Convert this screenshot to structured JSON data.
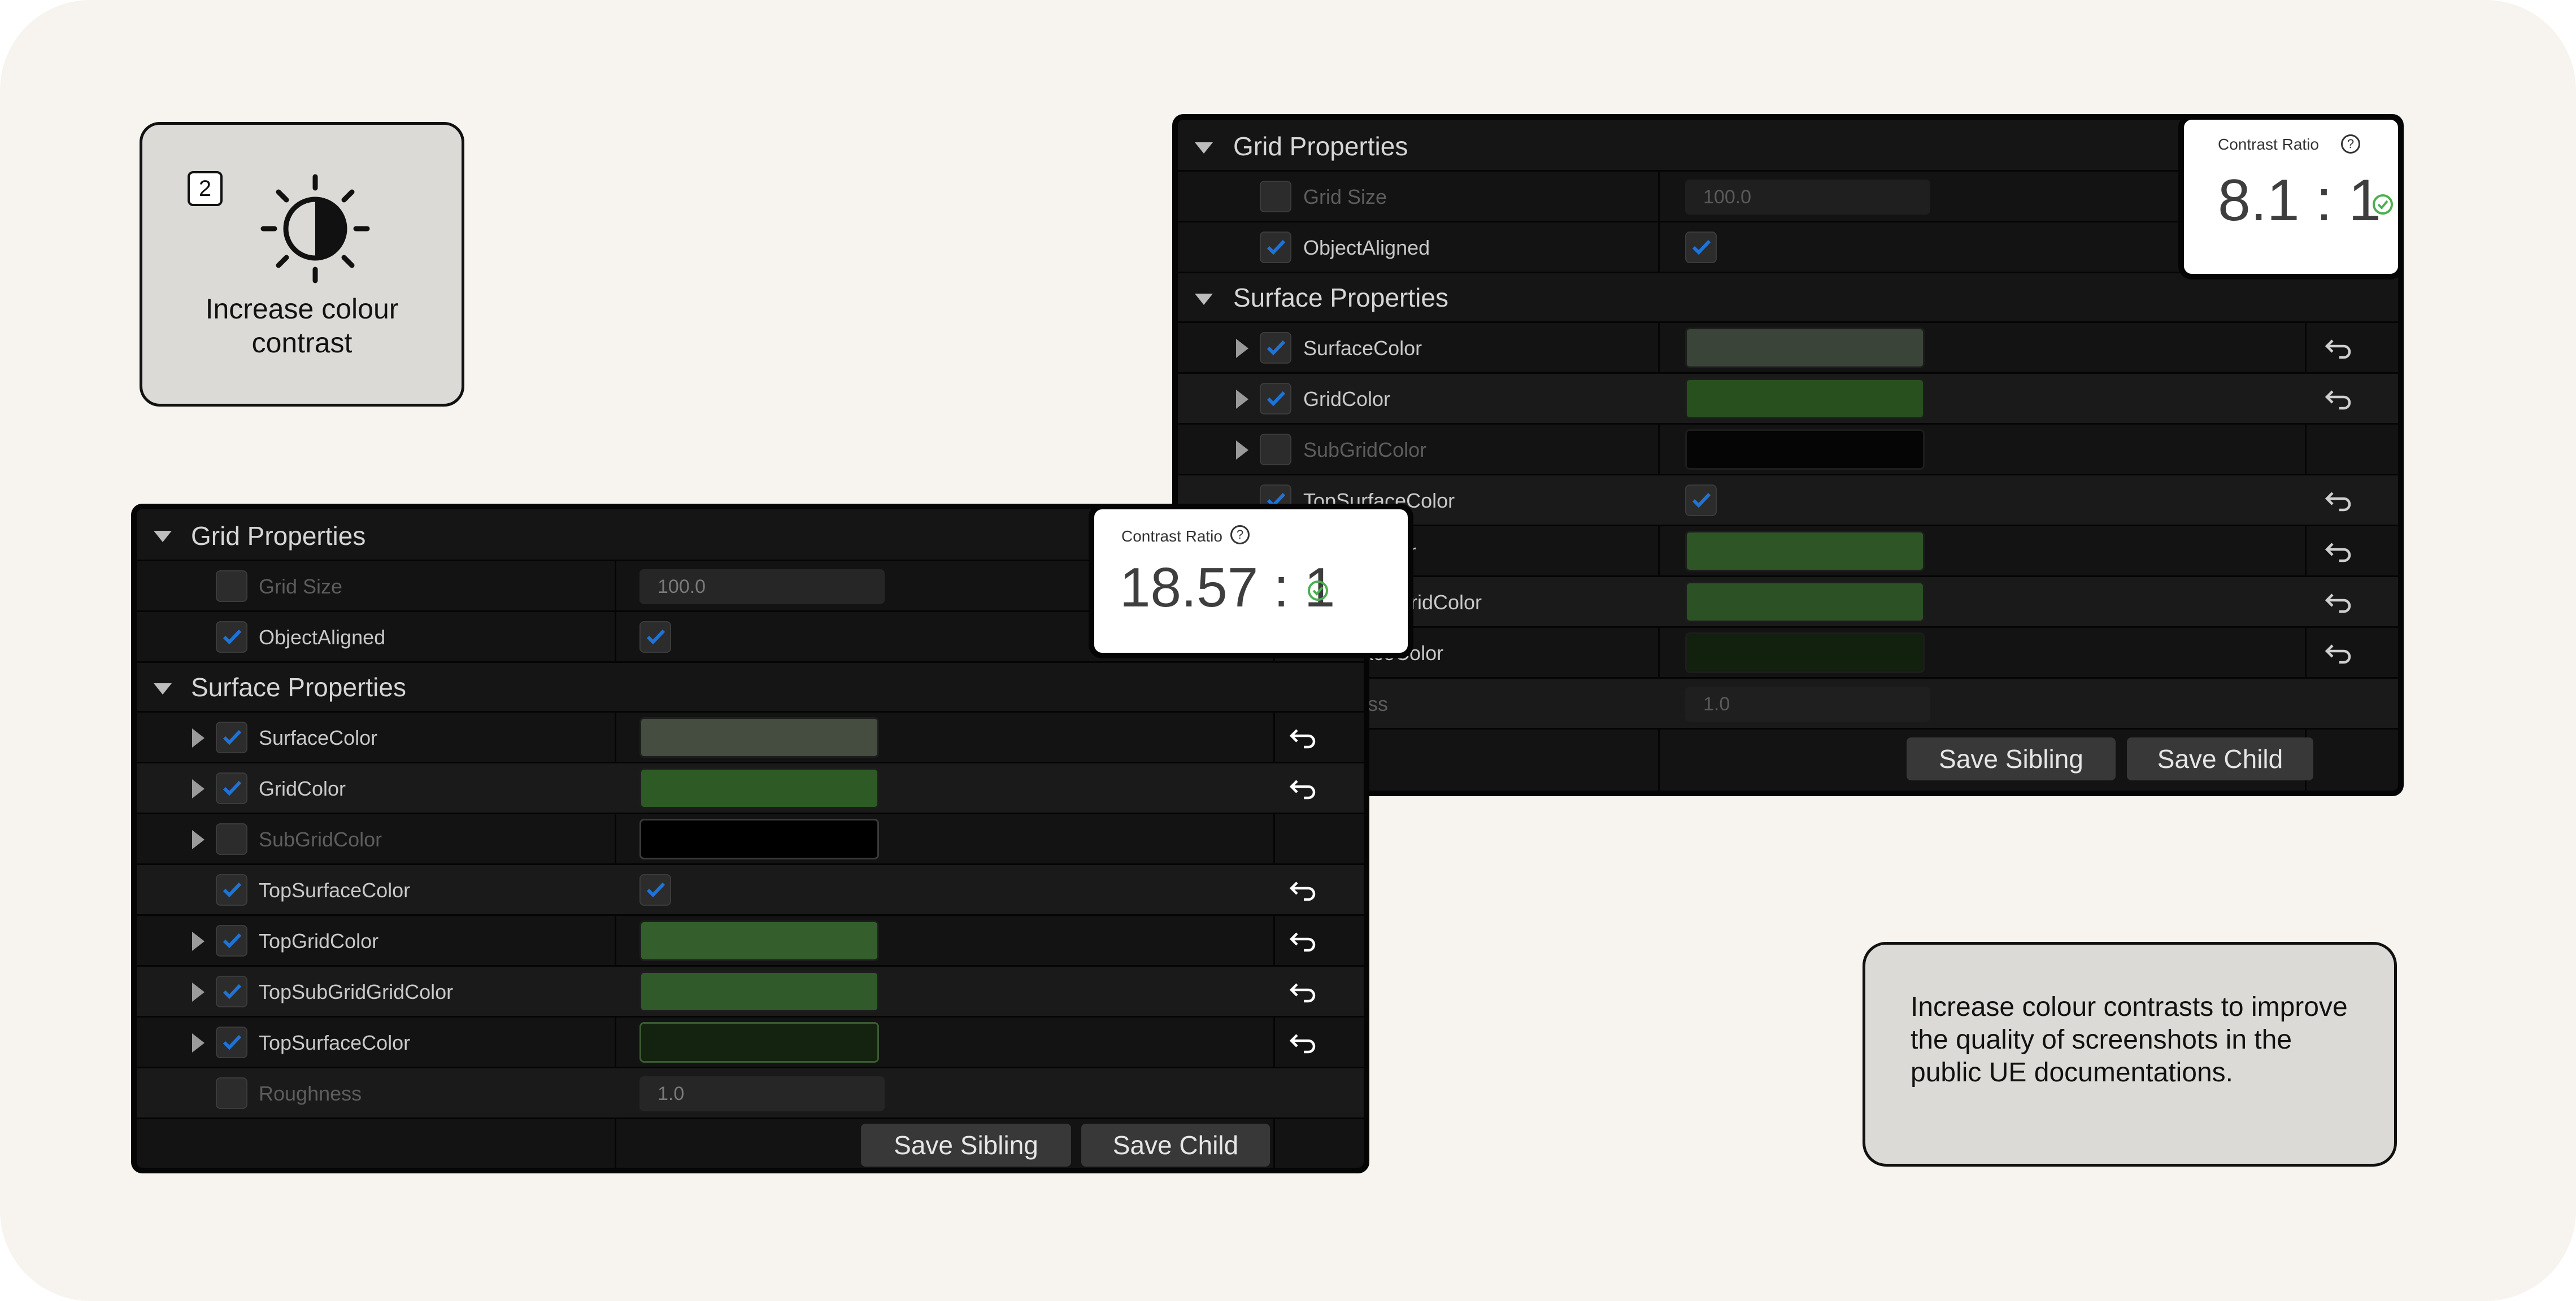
{
  "tip": {
    "number": "2",
    "icon": "contrast-sun-icon",
    "title": "Increase colour contrast"
  },
  "note": {
    "text": "Increase colour contrasts to improve the quality of screenshots in the public UE documentations."
  },
  "panel_after": {
    "categories": {
      "grid": "Grid Properties",
      "surface": "Surface Properties"
    },
    "grid_rows": [
      {
        "label": "Grid Size",
        "enabled": false,
        "value": "100.0"
      },
      {
        "label": "ObjectAligned",
        "enabled": true,
        "value_checked": true
      }
    ],
    "surface_rows": [
      {
        "label": "SurfaceColor",
        "enabled": true,
        "expandable": true,
        "color": "#444d40",
        "resettable": true
      },
      {
        "label": "GridColor",
        "enabled": true,
        "expandable": true,
        "color": "#2d5a25",
        "resettable": true
      },
      {
        "label": "SubGridColor",
        "enabled": false,
        "expandable": true,
        "color": "#000000",
        "resettable": false
      },
      {
        "label": "TopSurfaceColor",
        "enabled": true,
        "expandable": false,
        "value_checked": true,
        "resettable": true
      },
      {
        "label": "TopGridColor",
        "enabled": true,
        "expandable": true,
        "color": "#345f2c",
        "resettable": true
      },
      {
        "label": "TopSubGridGridColor",
        "enabled": true,
        "expandable": true,
        "color": "#305a2a",
        "resettable": true
      },
      {
        "label": "TopSurfaceColor",
        "enabled": true,
        "expandable": true,
        "color": "#13230f",
        "resettable": true
      },
      {
        "label": "Roughness",
        "enabled": false,
        "expandable": false,
        "value": "1.0",
        "resettable": false
      }
    ],
    "buttons": {
      "save_sibling": "Save Sibling",
      "save_child": "Save Child"
    },
    "contrast": {
      "label": "Contrast Ratio",
      "value": "18.57 : 1",
      "status": "pass"
    }
  },
  "panel_before": {
    "categories": {
      "grid": "Grid Properties",
      "surface": "Surface Properties"
    },
    "grid_rows": [
      {
        "label": "Grid Size",
        "enabled": false,
        "value": "100.0"
      },
      {
        "label": "ObjectAligned",
        "enabled": true,
        "value_checked": true
      }
    ],
    "surface_rows": [
      {
        "label": "SurfaceColor",
        "visible_text": "SurfaceColor",
        "color": "#3b4438"
      },
      {
        "label": "GridColor",
        "visible_text": "GridColor",
        "color": "#28501f"
      },
      {
        "label": "SubGridColor",
        "visible_text": "SubGridColor",
        "color": "#050505"
      },
      {
        "label": "TopSurfaceColor",
        "visible_text": "TopSurfaceColor",
        "value_checked": true
      },
      {
        "label": "TopGridColor",
        "visible_text": "dColor",
        "color": "#2e5526"
      },
      {
        "label": "TopSubGridGridColor",
        "visible_text": "GridGridColor",
        "color": "#2b5124"
      },
      {
        "label": "TopSurfaceColor",
        "visible_text": "faceColor",
        "color": "#12200e"
      },
      {
        "label": "Roughness",
        "visible_text": "ess",
        "value": "1.0"
      }
    ],
    "buttons": {
      "save_sibling": "Save Sibling",
      "save_child": "Save Child"
    },
    "contrast": {
      "label": "Contrast Ratio",
      "value": "8.1 : 1",
      "status": "pass"
    }
  },
  "colors": {
    "canvas": "#f7f4ef",
    "card": "#dcdad6",
    "panel_bg": "#131313",
    "checkbox_accent": "#1e73d6",
    "pass_green": "#4caf50"
  }
}
